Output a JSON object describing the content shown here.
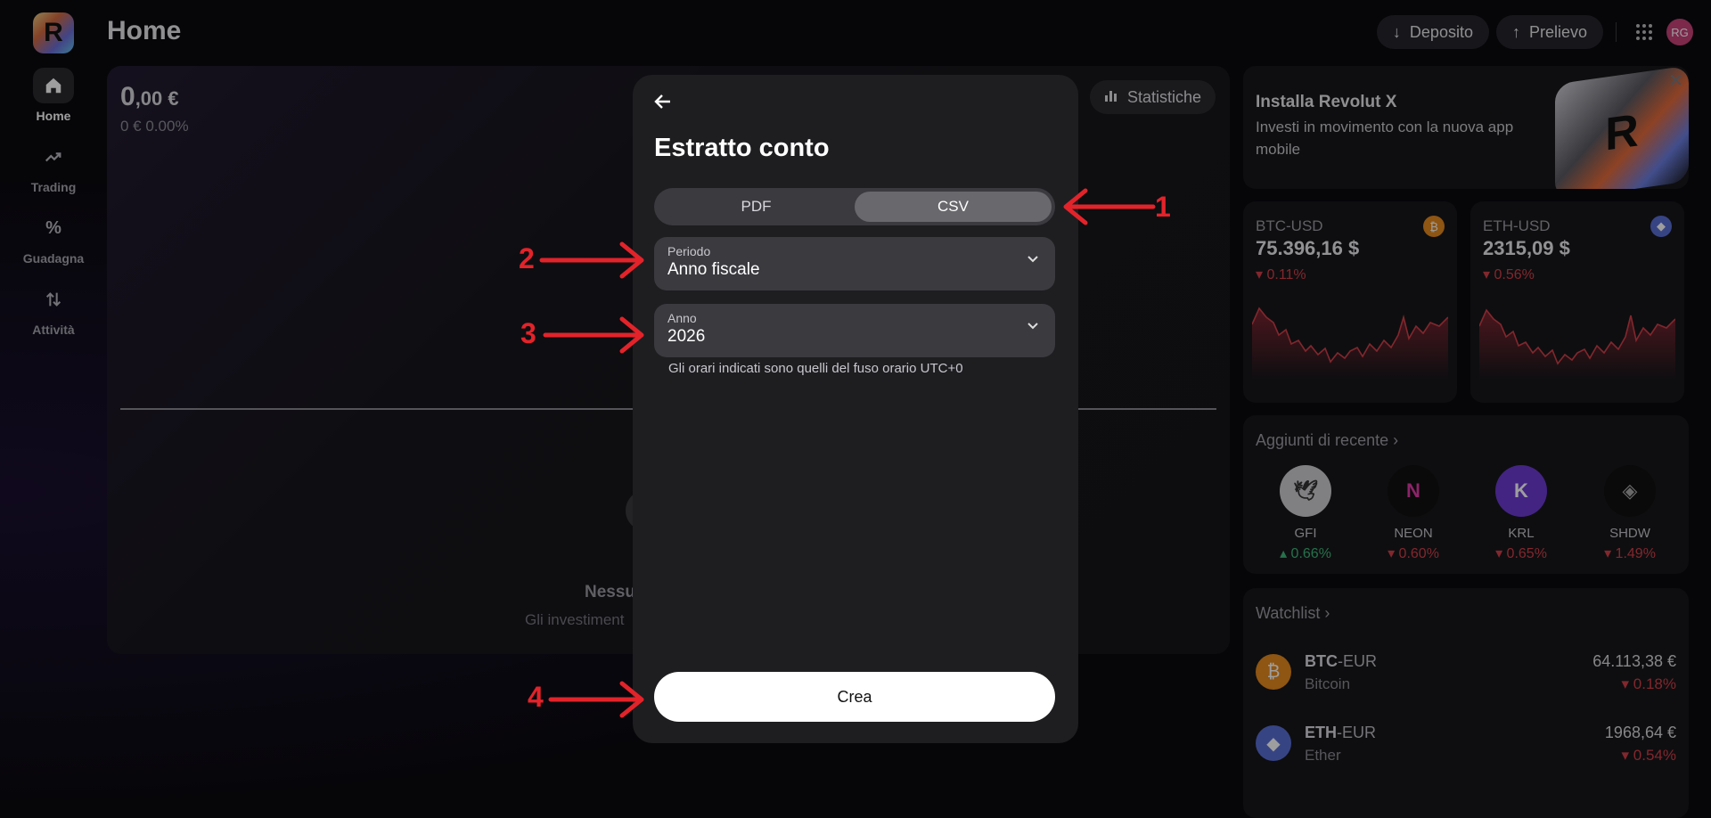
{
  "page": {
    "title": "Home"
  },
  "brand": {
    "logo_letter": "R"
  },
  "nav": [
    {
      "label": "Home",
      "icon": "home-icon"
    },
    {
      "label": "Trading",
      "icon": "trend-icon"
    },
    {
      "label": "Guadagna",
      "icon": "percent-icon"
    },
    {
      "label": "Attività",
      "icon": "transfer-icon"
    }
  ],
  "top": {
    "deposit": "Deposito",
    "withdraw": "Prelievo",
    "avatar": "RG"
  },
  "portfolio": {
    "balance_int": "0",
    "balance_dec": ",00 €",
    "change": "0 € 0.00%",
    "stats_label": "Statistiche",
    "empty_title": "Nessu",
    "empty_sub": "Gli investiment"
  },
  "promo": {
    "title": "Installa Revolut X",
    "text": "Investi in movimento con la nuova app mobile",
    "art_letter": "R"
  },
  "tickers": [
    {
      "symbol": "BTC-USD",
      "price": "75.396,16 $",
      "change": "▾ 0.11%"
    },
    {
      "symbol": "ETH-USD",
      "price": "2315,09 $",
      "change": "▾ 0.56%"
    }
  ],
  "recent": {
    "title": "Aggiunti di recente",
    "items": [
      {
        "symbol": "GFI",
        "change": "▴ 0.66%",
        "dir": "up"
      },
      {
        "symbol": "NEON",
        "change": "▾ 0.60%",
        "dir": "down"
      },
      {
        "symbol": "KRL",
        "change": "▾ 0.65%",
        "dir": "down"
      },
      {
        "symbol": "SHDW",
        "change": "▾ 1.49%",
        "dir": "down"
      }
    ]
  },
  "watchlist": {
    "title": "Watchlist",
    "items": [
      {
        "base": "BTC",
        "quote": "-EUR",
        "name": "Bitcoin",
        "price": "64.113,38 €",
        "change": "▾ 0.18%"
      },
      {
        "base": "ETH",
        "quote": "-EUR",
        "name": "Ether",
        "price": "1968,64 €",
        "change": "▾ 0.54%"
      }
    ]
  },
  "modal": {
    "title": "Estratto conto",
    "tabs": [
      "PDF",
      "CSV"
    ],
    "selected_tab": "CSV",
    "period_label": "Periodo",
    "period_value": "Anno fiscale",
    "year_label": "Anno",
    "year_value": "2026",
    "tz_note": "Gli orari indicati sono quelli del fuso orario UTC+0",
    "create_label": "Crea"
  },
  "annotations": [
    "1",
    "2",
    "3",
    "4"
  ]
}
